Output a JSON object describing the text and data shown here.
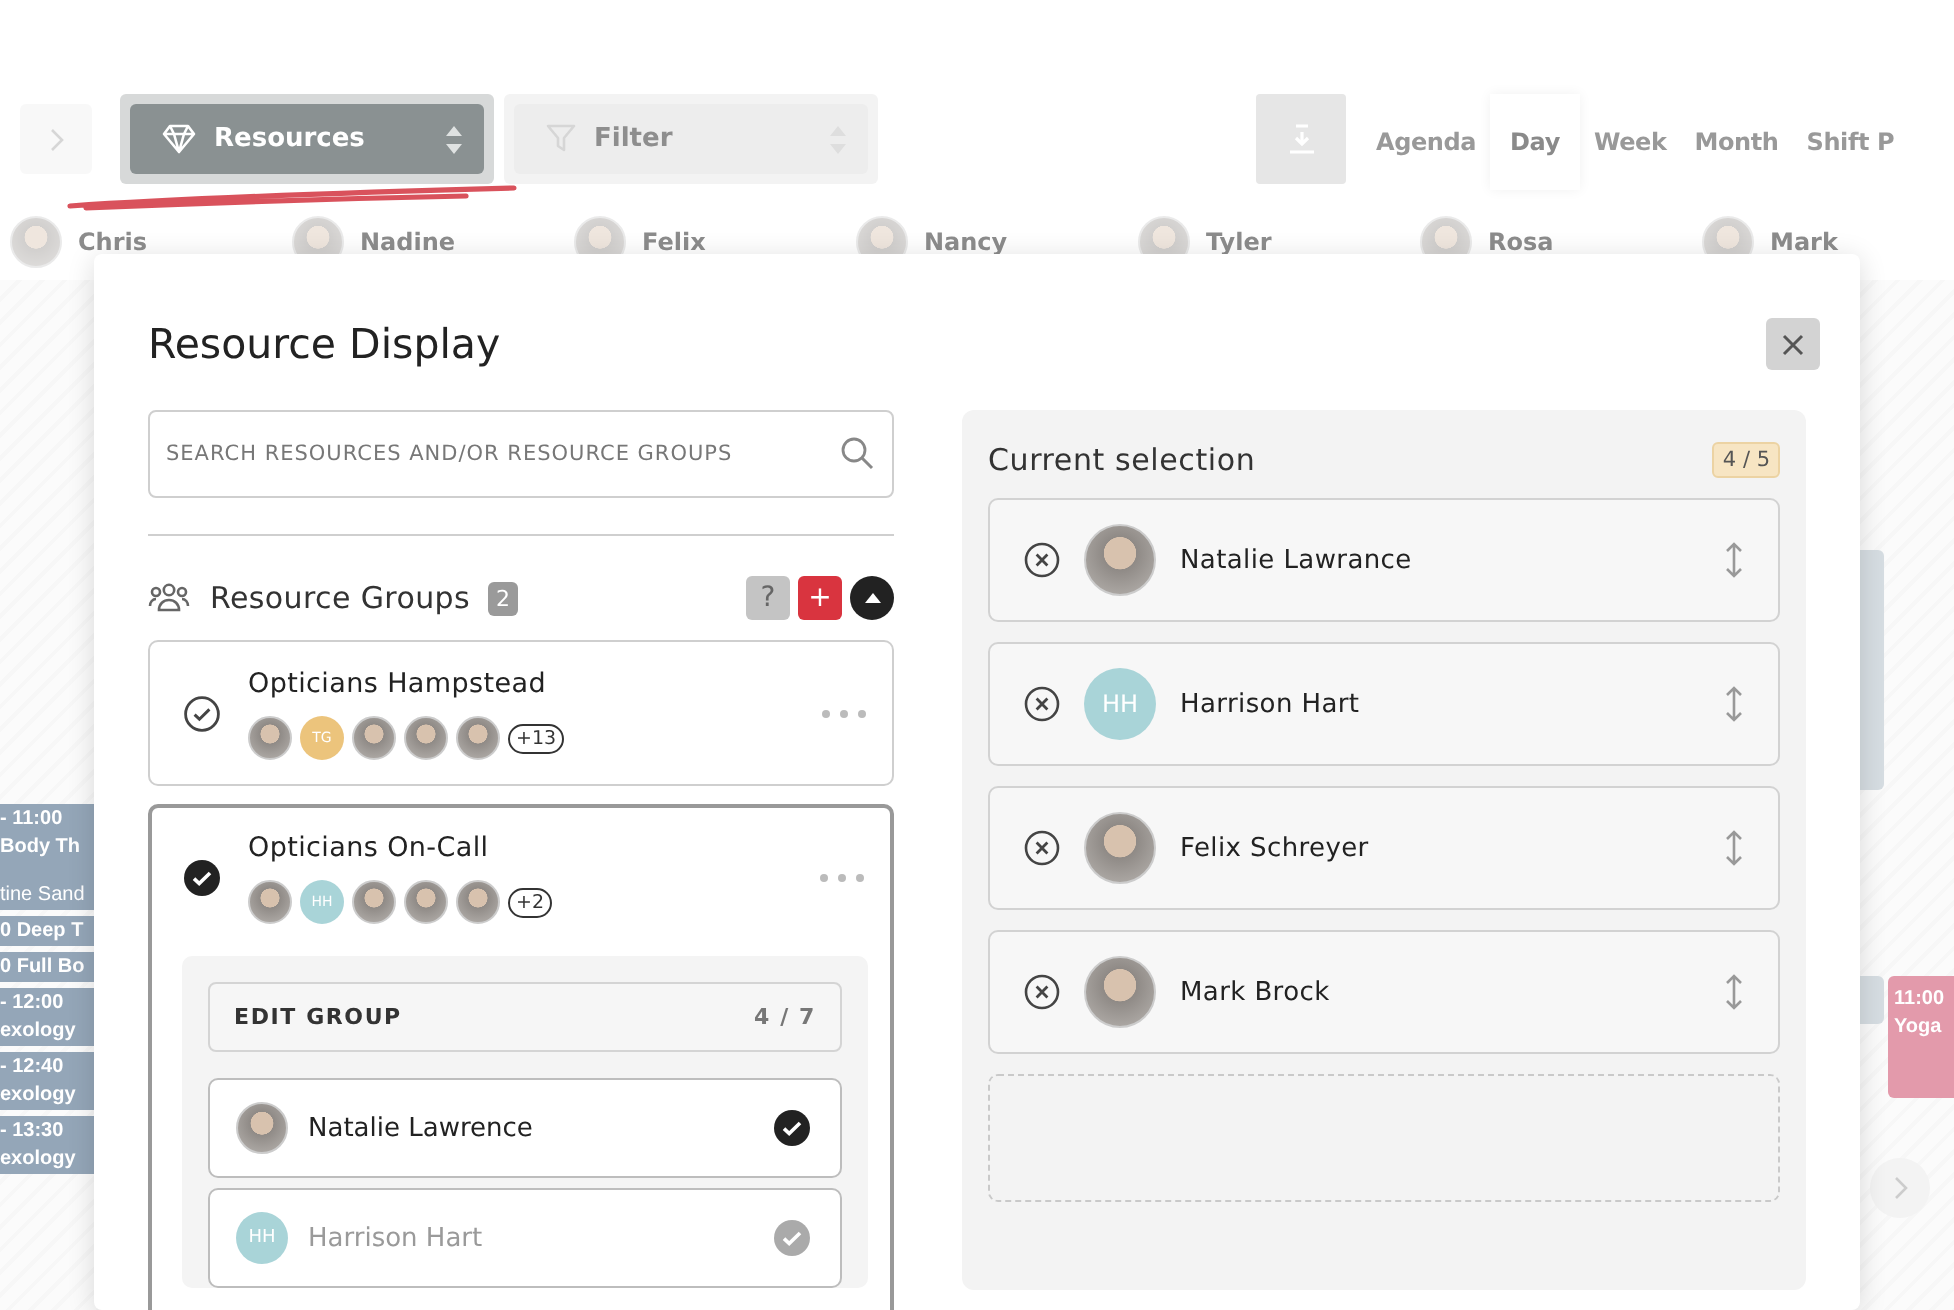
{
  "toolbar": {
    "resources_button": "Resources",
    "filter_button": "Filter",
    "views": [
      {
        "label": "Agenda",
        "selected": false
      },
      {
        "label": "Day",
        "selected": true
      },
      {
        "label": "Week",
        "selected": false
      },
      {
        "label": "Month",
        "selected": false
      },
      {
        "label": "Shift P",
        "selected": false
      }
    ]
  },
  "resource_strip": [
    "Chris",
    "Nadine",
    "Felix",
    "Nancy",
    "Tyler",
    "Rosa",
    "Mark"
  ],
  "calendar_events": [
    {
      "time": "- 11:00",
      "title": "Body Th",
      "detail": "tine Sand",
      "color": "#94a6b8"
    },
    {
      "title": "0 Deep T",
      "color": "#94a6b8"
    },
    {
      "title": "0 Full Bo",
      "color": "#94a6b8"
    },
    {
      "time": "- 12:00",
      "title": "exology",
      "color": "#94a6b8"
    },
    {
      "time": "- 12:40",
      "title": "exology",
      "color": "#94a6b8"
    },
    {
      "time": "- 13:30",
      "title": "exology",
      "color": "#94a6b8"
    },
    {
      "time": "11:00",
      "title": "Yoga",
      "color": "#e39aab"
    }
  ],
  "modal": {
    "title": "Resource Display",
    "search": {
      "placeholder": "SEARCH RESOURCES AND/OR RESOURCE GROUPS"
    },
    "groups_header": {
      "title": "Resource Groups",
      "count": "2",
      "help_button": "?",
      "add_button": "+"
    },
    "groups": [
      {
        "name": "Opticians Hampstead",
        "selected": false,
        "expanded": false,
        "avatars": [
          {
            "kind": "photo"
          },
          {
            "kind": "initials",
            "text": "TG",
            "color": "#ecc47c"
          },
          {
            "kind": "photo"
          },
          {
            "kind": "photo"
          },
          {
            "kind": "photo"
          }
        ],
        "more": "+13"
      },
      {
        "name": "Opticians On-Call",
        "selected": true,
        "expanded": true,
        "avatars": [
          {
            "kind": "photo"
          },
          {
            "kind": "initials",
            "text": "HH",
            "color": "#a9d4d8"
          },
          {
            "kind": "photo"
          },
          {
            "kind": "photo"
          },
          {
            "kind": "photo"
          }
        ],
        "more": "+2"
      }
    ],
    "edit_group": {
      "title": "EDIT GROUP",
      "count": "4 / 7",
      "members": [
        {
          "name": "Natalie Lawrence",
          "checked": true,
          "avatar": {
            "kind": "photo"
          }
        },
        {
          "name": "Harrison Hart",
          "checked": false,
          "avatar": {
            "kind": "initials",
            "text": "HH",
            "color": "#a9d4d8"
          }
        }
      ]
    },
    "selection": {
      "title": "Current selection",
      "count": "4 / 5",
      "items": [
        {
          "name": "Natalie Lawrance",
          "avatar": {
            "kind": "photo"
          }
        },
        {
          "name": "Harrison Hart",
          "avatar": {
            "kind": "initials",
            "text": "HH",
            "color": "#a9d4d8"
          }
        },
        {
          "name": "Felix Schreyer",
          "avatar": {
            "kind": "photo"
          }
        },
        {
          "name": "Mark Brock",
          "avatar": {
            "kind": "photo"
          }
        }
      ]
    }
  }
}
